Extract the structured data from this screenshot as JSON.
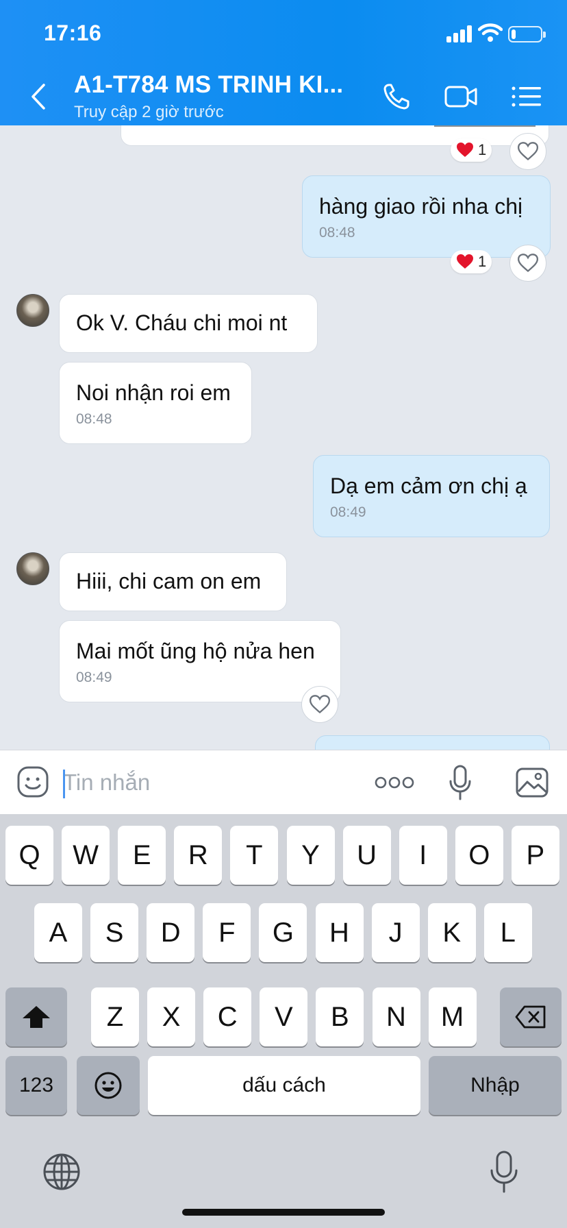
{
  "status_bar": {
    "time": "17:16"
  },
  "header": {
    "title": "A1-T784 MS TRINH KI...",
    "subtitle": "Truy cập 2 giờ trước",
    "icons": [
      "back-chevron-icon",
      "phone-icon",
      "video-call-icon",
      "menu-list-icon"
    ]
  },
  "messages": [
    {
      "side": "out",
      "text": "hàng giao rồi nha chị",
      "time": "08:48",
      "reaction_count": "1"
    },
    {
      "side": "in",
      "text": "Ok V. Cháu chi moi nt"
    },
    {
      "side": "in",
      "text": "Noi nhận roi em",
      "time": "08:48"
    },
    {
      "side": "out",
      "text": "Dạ em cảm ơn chị ạ",
      "time": "08:49"
    },
    {
      "side": "in",
      "text": "Hiii, chi cam on em"
    },
    {
      "side": "in",
      "text": "Mai mốt ũng hộ nửa hen",
      "time": "08:49"
    }
  ],
  "partial_top": {
    "reaction_count": "1"
  },
  "input": {
    "placeholder": "Tin nhắn"
  },
  "keyboard": {
    "row1": [
      "Q",
      "W",
      "E",
      "R",
      "T",
      "Y",
      "U",
      "I",
      "O",
      "P"
    ],
    "row2": [
      "A",
      "S",
      "D",
      "F",
      "G",
      "H",
      "J",
      "K",
      "L"
    ],
    "row3": [
      "Z",
      "X",
      "C",
      "V",
      "B",
      "N",
      "M"
    ],
    "numbers_label": "123",
    "space_label": "dấu cách",
    "return_label": "Nhập"
  }
}
